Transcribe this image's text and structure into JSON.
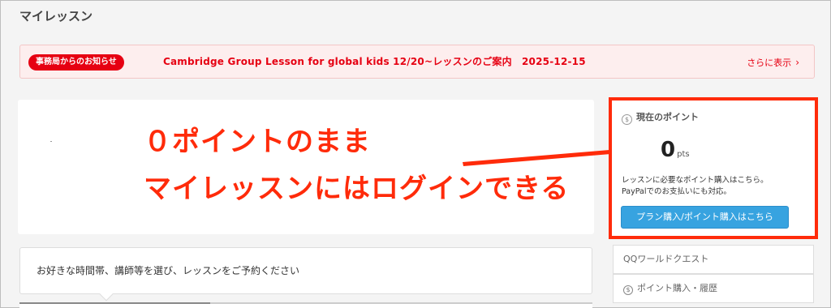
{
  "page": {
    "title": "マイレッスン"
  },
  "notice": {
    "badge": "事務局からのお知らせ",
    "text": "Cambridge Group Lesson for global kids 12/20~レッスンのご案内　2025-12-15",
    "more": "さらに表示",
    "more_icon": "chevron-right-icon",
    "accent": "#e60012"
  },
  "annotation": {
    "line1": "０ポイントのまま",
    "line2": "マイレッスンにはログインできる",
    "color": "#ff2b0a"
  },
  "points": {
    "heading": "現在のポイント",
    "heading_icon": "coin-icon",
    "value": "0",
    "unit": "pts",
    "desc1": "レッスンに必要なポイント購入はこちら。",
    "desc2": "PayPalでのお支払いにも対応。",
    "buy_button": "プラン購入/ポイント購入はこちら",
    "button_color": "#37a3e0"
  },
  "sidebar": {
    "items": [
      {
        "label": "QQワールドクエスト"
      },
      {
        "label": "ポイント購入・履歴",
        "icon": "yen-coin-icon"
      }
    ]
  },
  "reserve": {
    "prompt": "お好きな時間帯、講師等を選び、レッスンをご予約ください"
  }
}
